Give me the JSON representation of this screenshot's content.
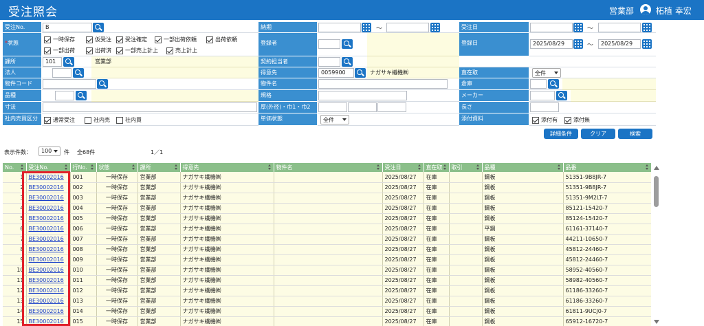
{
  "header": {
    "title": "受注照会",
    "department": "営業部",
    "user_name": "柘植 幸宏"
  },
  "form": {
    "order_no_label": "受注No.",
    "order_no_value": "B",
    "delivery_label": "納期",
    "order_date_label": "受注日",
    "tilde": "～",
    "status_label": "状態",
    "status_required_mark": "*",
    "status_options": [
      "一時保存",
      "仮受注",
      "受注確定",
      "一部出荷依頼",
      "出荷依頼",
      "一部出荷",
      "出荷済",
      "一部売上計上",
      "売上計上"
    ],
    "registrant_label": "登録者",
    "reg_date_label": "登録日",
    "reg_date_from": "2025/08/29",
    "reg_date_to": "2025/08/29",
    "section_label": "課所",
    "section_code": "101",
    "section_name": "営業部",
    "contract_staff_label": "契約担当者",
    "corporation_label": "法人",
    "customer_label": "得意先",
    "customer_code": "0059900",
    "customer_name": "ナガサキ繊機㈱",
    "direct_label": "直在取",
    "direct_value": "全件",
    "property_code_label": "物件コード",
    "property_name_label": "物件名",
    "warehouse_label": "倉庫",
    "product_label": "品種",
    "spec_label": "規格",
    "maker_label": "メーカー",
    "size_label": "寸法",
    "thickness_label": "厚(外径)・巾1・巾2",
    "length_label": "長さ",
    "internal_label": "社内売買区分",
    "internal_options": [
      "通常受注",
      "社内売",
      "社内買"
    ],
    "unit_price_label": "単価状態",
    "unit_price_value": "全件",
    "attachment_label": "添付資料",
    "attachment_options": [
      "添付有",
      "添付無"
    ]
  },
  "buttons": {
    "detail": "詳細条件",
    "clear": "クリア",
    "search": "検索"
  },
  "list_meta": {
    "display_count_label": "表示件数：",
    "display_count_value": "100",
    "display_count_unit": "件",
    "total": "全68件",
    "page": "1／1"
  },
  "table": {
    "columns": [
      "No.",
      "受注No.",
      "行No.",
      "状態",
      "課所",
      "得意先",
      "物件名",
      "受注日",
      "直在取",
      "取引",
      "品種",
      "品番"
    ],
    "rows": [
      [
        "1",
        "BE30002016",
        "001",
        "一時保存",
        "営業部",
        "ナガサキ繊機㈱",
        "",
        "2025/08/27",
        "在庫",
        "",
        "鋼板",
        "51351-9B8JR-7"
      ],
      [
        "2",
        "BE30002016",
        "002",
        "一時保存",
        "営業部",
        "ナガサキ繊機㈱",
        "",
        "2025/08/27",
        "在庫",
        "",
        "鋼板",
        "51351-9B8JR-7"
      ],
      [
        "3",
        "BE30002016",
        "003",
        "一時保存",
        "営業部",
        "ナガサキ繊機㈱",
        "",
        "2025/08/27",
        "在庫",
        "",
        "鋼板",
        "51351-9M2LT-7"
      ],
      [
        "4",
        "BE30002016",
        "004",
        "一時保存",
        "営業部",
        "ナガサキ繊機㈱",
        "",
        "2025/08/27",
        "在庫",
        "",
        "鋼板",
        "85121-15420-7"
      ],
      [
        "5",
        "BE30002016",
        "005",
        "一時保存",
        "営業部",
        "ナガサキ繊機㈱",
        "",
        "2025/08/27",
        "在庫",
        "",
        "鋼板",
        "85124-15420-7"
      ],
      [
        "6",
        "BE30002016",
        "006",
        "一時保存",
        "営業部",
        "ナガサキ繊機㈱",
        "",
        "2025/08/27",
        "在庫",
        "",
        "平鋼",
        "61161-37140-7"
      ],
      [
        "7",
        "BE30002016",
        "007",
        "一時保存",
        "営業部",
        "ナガサキ繊機㈱",
        "",
        "2025/08/27",
        "在庫",
        "",
        "鋼板",
        "44211-10650-7"
      ],
      [
        "8",
        "BE30002016",
        "008",
        "一時保存",
        "営業部",
        "ナガサキ繊機㈱",
        "",
        "2025/08/27",
        "在庫",
        "",
        "鋼板",
        "45812-24460-7"
      ],
      [
        "9",
        "BE30002016",
        "009",
        "一時保存",
        "営業部",
        "ナガサキ繊機㈱",
        "",
        "2025/08/27",
        "在庫",
        "",
        "鋼板",
        "45812-24460-7"
      ],
      [
        "10",
        "BE30002016",
        "010",
        "一時保存",
        "営業部",
        "ナガサキ繊機㈱",
        "",
        "2025/08/27",
        "在庫",
        "",
        "鋼板",
        "58952-40560-7"
      ],
      [
        "11",
        "BE30002016",
        "011",
        "一時保存",
        "営業部",
        "ナガサキ繊機㈱",
        "",
        "2025/08/27",
        "在庫",
        "",
        "鋼板",
        "58982-40560-7"
      ],
      [
        "12",
        "BE30002016",
        "012",
        "一時保存",
        "営業部",
        "ナガサキ繊機㈱",
        "",
        "2025/08/27",
        "在庫",
        "",
        "鋼板",
        "61186-33260-7"
      ],
      [
        "13",
        "BE30002016",
        "013",
        "一時保存",
        "営業部",
        "ナガサキ繊機㈱",
        "",
        "2025/08/27",
        "在庫",
        "",
        "鋼板",
        "61186-33260-7"
      ],
      [
        "14",
        "BE30002016",
        "014",
        "一時保存",
        "営業部",
        "ナガサキ繊機㈱",
        "",
        "2025/08/27",
        "在庫",
        "",
        "鋼板",
        "61811-9UCJ0-7"
      ],
      [
        "15",
        "BE30002016",
        "015",
        "一時保存",
        "営業部",
        "ナガサキ繊機㈱",
        "",
        "2025/08/27",
        "在庫",
        "",
        "鋼板",
        "65912-16720-7"
      ]
    ]
  }
}
